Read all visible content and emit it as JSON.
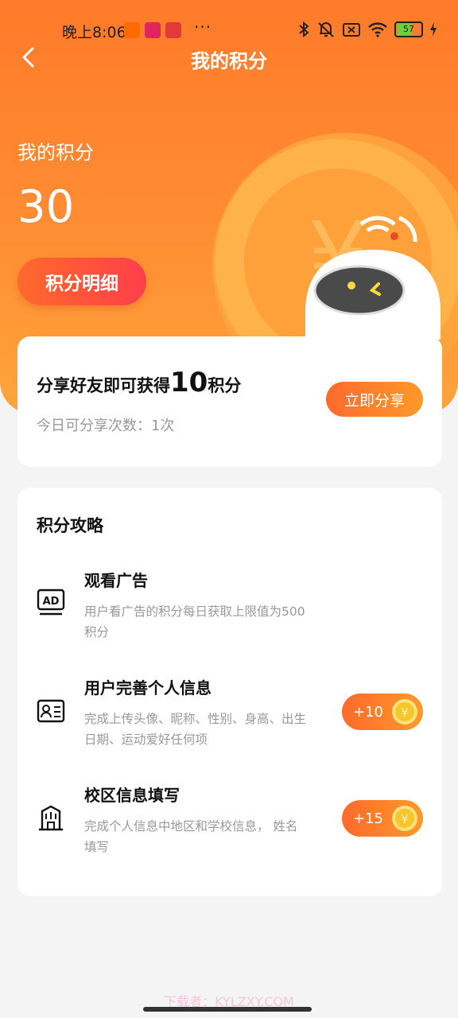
{
  "status_bar": {
    "time": "晚上8:06",
    "dots": "···",
    "battery": "57"
  },
  "header": {
    "title": "我的积分"
  },
  "summary": {
    "label": "我的积分",
    "points": "30",
    "detail_button": "积分明细"
  },
  "share": {
    "title_prefix": "分享好友即可获得",
    "title_number": "10",
    "title_suffix": "积分",
    "subtitle": "今日可分享次数：1次",
    "button": "立即分享"
  },
  "guide": {
    "title": "积分攻略",
    "tasks": [
      {
        "name": "观看广告",
        "desc": "用户看广告的积分每日获取上限值为500积分",
        "icon": "ad-icon"
      },
      {
        "name": "用户完善个人信息",
        "desc": "完成上传头像、昵称、性别、身高、出生日期、运动爱好任何项",
        "reward": "+10",
        "icon": "id-card-icon"
      },
      {
        "name": "校区信息填写",
        "desc": "完成个人信息中地区和学校信息， 姓名填写",
        "reward": "+15",
        "icon": "building-icon"
      }
    ]
  },
  "watermark": "下载者：KYLZXY.COM",
  "colors": {
    "brand_orange": "#ff7a2a",
    "button_red": "#ff3f4a",
    "coin_gold": "#f6c62c"
  }
}
